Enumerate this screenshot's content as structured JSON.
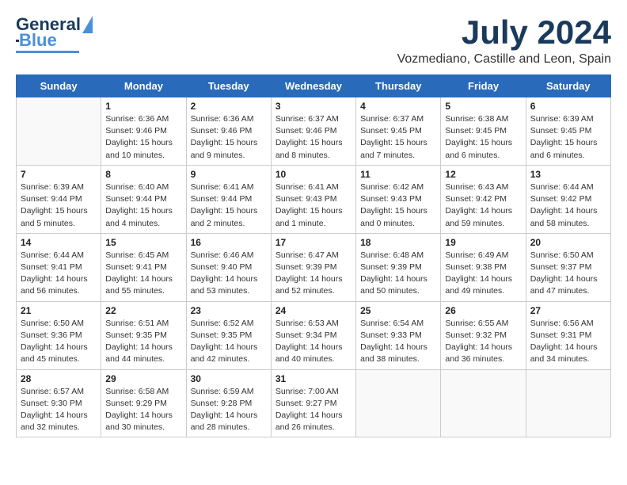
{
  "header": {
    "logo_line1": "General",
    "logo_line2": "Blue",
    "month_year": "July 2024",
    "location": "Vozmediano, Castille and Leon, Spain"
  },
  "days_of_week": [
    "Sunday",
    "Monday",
    "Tuesday",
    "Wednesday",
    "Thursday",
    "Friday",
    "Saturday"
  ],
  "weeks": [
    [
      {
        "day": "",
        "info": ""
      },
      {
        "day": "1",
        "info": "Sunrise: 6:36 AM\nSunset: 9:46 PM\nDaylight: 15 hours\nand 10 minutes."
      },
      {
        "day": "2",
        "info": "Sunrise: 6:36 AM\nSunset: 9:46 PM\nDaylight: 15 hours\nand 9 minutes."
      },
      {
        "day": "3",
        "info": "Sunrise: 6:37 AM\nSunset: 9:46 PM\nDaylight: 15 hours\nand 8 minutes."
      },
      {
        "day": "4",
        "info": "Sunrise: 6:37 AM\nSunset: 9:45 PM\nDaylight: 15 hours\nand 7 minutes."
      },
      {
        "day": "5",
        "info": "Sunrise: 6:38 AM\nSunset: 9:45 PM\nDaylight: 15 hours\nand 6 minutes."
      },
      {
        "day": "6",
        "info": "Sunrise: 6:39 AM\nSunset: 9:45 PM\nDaylight: 15 hours\nand 6 minutes."
      }
    ],
    [
      {
        "day": "7",
        "info": "Sunrise: 6:39 AM\nSunset: 9:44 PM\nDaylight: 15 hours\nand 5 minutes."
      },
      {
        "day": "8",
        "info": "Sunrise: 6:40 AM\nSunset: 9:44 PM\nDaylight: 15 hours\nand 4 minutes."
      },
      {
        "day": "9",
        "info": "Sunrise: 6:41 AM\nSunset: 9:44 PM\nDaylight: 15 hours\nand 2 minutes."
      },
      {
        "day": "10",
        "info": "Sunrise: 6:41 AM\nSunset: 9:43 PM\nDaylight: 15 hours\nand 1 minute."
      },
      {
        "day": "11",
        "info": "Sunrise: 6:42 AM\nSunset: 9:43 PM\nDaylight: 15 hours\nand 0 minutes."
      },
      {
        "day": "12",
        "info": "Sunrise: 6:43 AM\nSunset: 9:42 PM\nDaylight: 14 hours\nand 59 minutes."
      },
      {
        "day": "13",
        "info": "Sunrise: 6:44 AM\nSunset: 9:42 PM\nDaylight: 14 hours\nand 58 minutes."
      }
    ],
    [
      {
        "day": "14",
        "info": "Sunrise: 6:44 AM\nSunset: 9:41 PM\nDaylight: 14 hours\nand 56 minutes."
      },
      {
        "day": "15",
        "info": "Sunrise: 6:45 AM\nSunset: 9:41 PM\nDaylight: 14 hours\nand 55 minutes."
      },
      {
        "day": "16",
        "info": "Sunrise: 6:46 AM\nSunset: 9:40 PM\nDaylight: 14 hours\nand 53 minutes."
      },
      {
        "day": "17",
        "info": "Sunrise: 6:47 AM\nSunset: 9:39 PM\nDaylight: 14 hours\nand 52 minutes."
      },
      {
        "day": "18",
        "info": "Sunrise: 6:48 AM\nSunset: 9:39 PM\nDaylight: 14 hours\nand 50 minutes."
      },
      {
        "day": "19",
        "info": "Sunrise: 6:49 AM\nSunset: 9:38 PM\nDaylight: 14 hours\nand 49 minutes."
      },
      {
        "day": "20",
        "info": "Sunrise: 6:50 AM\nSunset: 9:37 PM\nDaylight: 14 hours\nand 47 minutes."
      }
    ],
    [
      {
        "day": "21",
        "info": "Sunrise: 6:50 AM\nSunset: 9:36 PM\nDaylight: 14 hours\nand 45 minutes."
      },
      {
        "day": "22",
        "info": "Sunrise: 6:51 AM\nSunset: 9:35 PM\nDaylight: 14 hours\nand 44 minutes."
      },
      {
        "day": "23",
        "info": "Sunrise: 6:52 AM\nSunset: 9:35 PM\nDaylight: 14 hours\nand 42 minutes."
      },
      {
        "day": "24",
        "info": "Sunrise: 6:53 AM\nSunset: 9:34 PM\nDaylight: 14 hours\nand 40 minutes."
      },
      {
        "day": "25",
        "info": "Sunrise: 6:54 AM\nSunset: 9:33 PM\nDaylight: 14 hours\nand 38 minutes."
      },
      {
        "day": "26",
        "info": "Sunrise: 6:55 AM\nSunset: 9:32 PM\nDaylight: 14 hours\nand 36 minutes."
      },
      {
        "day": "27",
        "info": "Sunrise: 6:56 AM\nSunset: 9:31 PM\nDaylight: 14 hours\nand 34 minutes."
      }
    ],
    [
      {
        "day": "28",
        "info": "Sunrise: 6:57 AM\nSunset: 9:30 PM\nDaylight: 14 hours\nand 32 minutes."
      },
      {
        "day": "29",
        "info": "Sunrise: 6:58 AM\nSunset: 9:29 PM\nDaylight: 14 hours\nand 30 minutes."
      },
      {
        "day": "30",
        "info": "Sunrise: 6:59 AM\nSunset: 9:28 PM\nDaylight: 14 hours\nand 28 minutes."
      },
      {
        "day": "31",
        "info": "Sunrise: 7:00 AM\nSunset: 9:27 PM\nDaylight: 14 hours\nand 26 minutes."
      },
      {
        "day": "",
        "info": ""
      },
      {
        "day": "",
        "info": ""
      },
      {
        "day": "",
        "info": ""
      }
    ]
  ]
}
